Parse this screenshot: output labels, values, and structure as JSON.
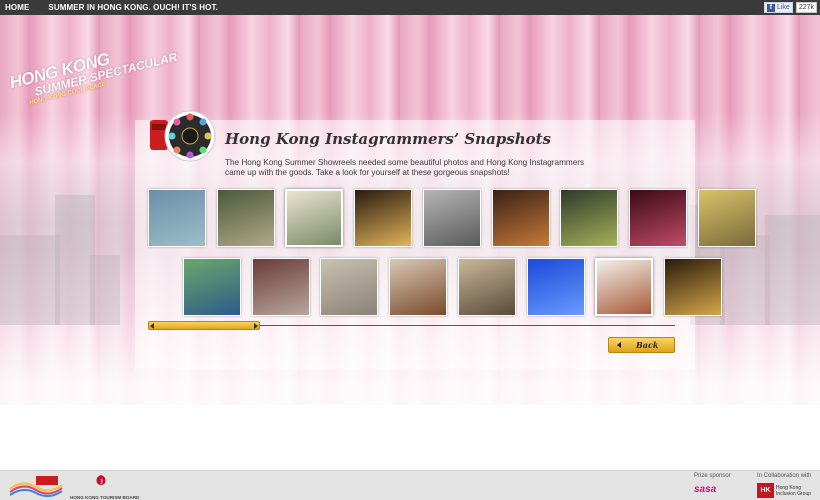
{
  "nav": {
    "home": "HOME",
    "summer": "SUMMER IN HONG KONG. OUCH! IT'S HOT.",
    "like_label": "Like",
    "like_count": "227k"
  },
  "logo": {
    "line1": "HONG KONG",
    "line2": "SUMMER SPECTACULAR",
    "line3": "HONG KONG COOL PLACE"
  },
  "main": {
    "title": "Hong Kong Instagrammers’ Snapshots",
    "intro": "The Hong Kong Summer Showreels needed some beautiful photos and Hong Kong Instagrammers came up with the goods. Take a look for yourself at these gorgeous snapshots!",
    "back_label": "Back"
  },
  "footer": {
    "hktb": "HONG KONG TOURISM BOARD",
    "prize_sponsor": "Prize sponsor",
    "sponsor_name": "sasa",
    "collab": "In Collaboration with",
    "hk_box": "HK",
    "hk_name1": "Hong Kong",
    "hk_name2": "Inclusion Group"
  },
  "colors": {
    "accent": "#e8a8c0",
    "button": "#f1c03a",
    "topbar": "#3a3a3a"
  },
  "gallery": {
    "row1": [
      {
        "name": "photo-harbour-boats",
        "c1": "#6b8fa8",
        "c2": "#9dbdc8"
      },
      {
        "name": "photo-street-stairs",
        "c1": "#4a5a3a",
        "c2": "#b2a888"
      },
      {
        "name": "photo-cable-car",
        "c1": "#e9e4cf",
        "c2": "#7a8a68"
      },
      {
        "name": "photo-neon-carousel",
        "c1": "#2a1a10",
        "c2": "#e2b55a"
      },
      {
        "name": "photo-spiral-stair",
        "c1": "#b5b5b5",
        "c2": "#5a5a5a"
      },
      {
        "name": "photo-mountains-sunset",
        "c1": "#3a2016",
        "c2": "#c77a3a"
      },
      {
        "name": "photo-bridge-night",
        "c1": "#2e3a2a",
        "c2": "#a6b05a"
      },
      {
        "name": "photo-neon-street",
        "c1": "#3a0a14",
        "c2": "#c24a6a"
      },
      {
        "name": "photo-beach-sunset",
        "c1": "#d8c26a",
        "c2": "#7a6a3a"
      }
    ],
    "row2": [
      {
        "name": "photo-racecourse",
        "c1": "#6aa86a",
        "c2": "#2e5a8a"
      },
      {
        "name": "photo-rainy-street",
        "c1": "#6a3a3a",
        "c2": "#b8a89a"
      },
      {
        "name": "photo-escalator",
        "c1": "#c8c2b2",
        "c2": "#8a8276"
      },
      {
        "name": "photo-dim-sum",
        "c1": "#d8c8b8",
        "c2": "#7a4a2a"
      },
      {
        "name": "photo-crowd-street",
        "c1": "#c9b89a",
        "c2": "#5a4a3a"
      },
      {
        "name": "photo-dragon-sky",
        "c1": "#1a4ad8",
        "c2": "#6a9aff"
      },
      {
        "name": "photo-clock-tower",
        "c1": "#f2f0ea",
        "c2": "#a85a3a"
      },
      {
        "name": "photo-night-market",
        "c1": "#2a1a0a",
        "c2": "#d6a84a"
      }
    ]
  }
}
